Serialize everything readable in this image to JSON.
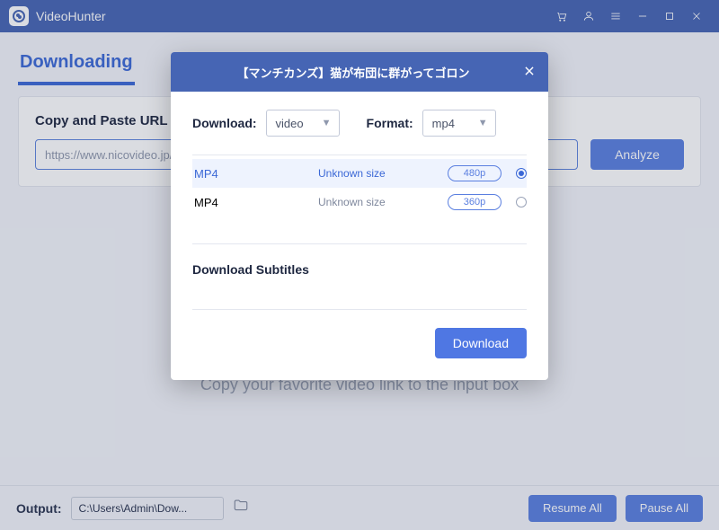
{
  "titlebar": {
    "app_name": "VideoHunter"
  },
  "tabs": {
    "downloading": "Downloading"
  },
  "card": {
    "title": "Copy and Paste URL",
    "url_placeholder": "https://www.nicovideo.jp/watch/...",
    "analyze": "Analyze"
  },
  "hint": "Copy your favorite video link to the input box",
  "footer": {
    "output_label": "Output:",
    "output_path": "C:\\Users\\Admin\\Dow...",
    "resume_all": "Resume All",
    "pause_all": "Pause All"
  },
  "dialog": {
    "title": "【マンチカンズ】猫が布団に群がってゴロン",
    "download_label": "Download:",
    "download_value": "video",
    "format_label": "Format:",
    "format_value": "mp4",
    "options": [
      {
        "format": "MP4",
        "size": "Unknown size",
        "quality": "480p",
        "selected": true
      },
      {
        "format": "MP4",
        "size": "Unknown size",
        "quality": "360p",
        "selected": false
      }
    ],
    "subtitles_label": "Download Subtitles",
    "download_button": "Download"
  }
}
